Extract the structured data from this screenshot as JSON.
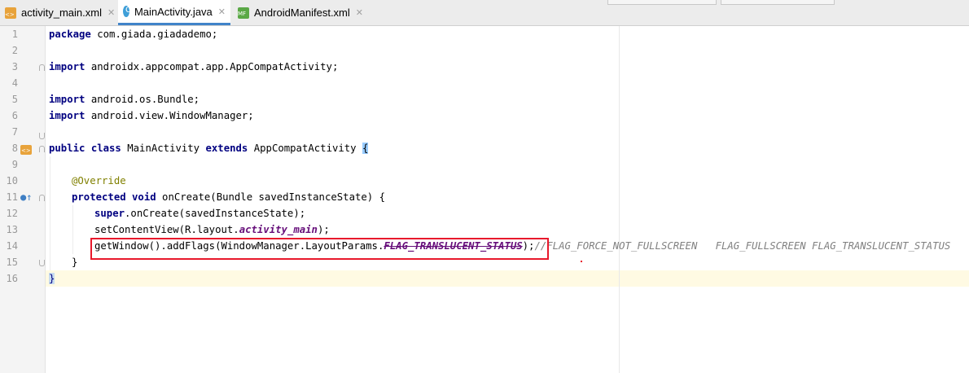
{
  "tabs": [
    {
      "label": "activity_main.xml",
      "icon": "xml-layout-icon",
      "close": "✕",
      "active": false
    },
    {
      "label": "MainActivity.java",
      "icon": "java-class-icon",
      "close": "✕",
      "active": true
    },
    {
      "label": "AndroidManifest.xml",
      "icon": "manifest-icon",
      "close": "✕",
      "active": false
    }
  ],
  "line_numbers": [
    "1",
    "2",
    "3",
    "4",
    "5",
    "6",
    "7",
    "8",
    "9",
    "10",
    "11",
    "12",
    "13",
    "14",
    "15",
    "16"
  ],
  "code": {
    "l1_kw": "package",
    "l1_rest": " com.giada.giadademo;",
    "l3_kw": "import",
    "l3_rest": " androidx.appcompat.app.AppCompatActivity;",
    "l5_kw": "import",
    "l5_rest": " android.os.Bundle;",
    "l6_kw": "import",
    "l6_rest": " android.view.WindowManager;",
    "l8_kw1": "public class",
    "l8_mid": " MainActivity ",
    "l8_kw2": "extends",
    "l8_rest": " AppCompatActivity ",
    "l8_brace": "{",
    "l10_ann": "@Override",
    "l11_kw": "protected void",
    "l11_rest": " onCreate(Bundle savedInstanceState) {",
    "l12_kw": "super",
    "l12_rest": ".onCreate(savedInstanceState);",
    "l13_pre": "setContentView(R.layout.",
    "l13_field": "activity_main",
    "l13_post": ");",
    "l14_pre": "getWindow().addFlags(WindowManager.LayoutParams.",
    "l14_field": "FLAG_TRANSLUCENT_STATUS",
    "l14_post": ");",
    "l14_comment": "//FLAG_FORCE_NOT_FULLSCREEN   FLAG_FULLSCREEN FLAG_TRANSLUCENT_STATUS",
    "l15": "}",
    "l16": "}"
  },
  "colors": {
    "keyword": "#000080",
    "annotation": "#808000",
    "field": "#660e7a",
    "comment": "#808080",
    "highlight_box": "#e8192c",
    "caret_line": "#fffae3"
  }
}
